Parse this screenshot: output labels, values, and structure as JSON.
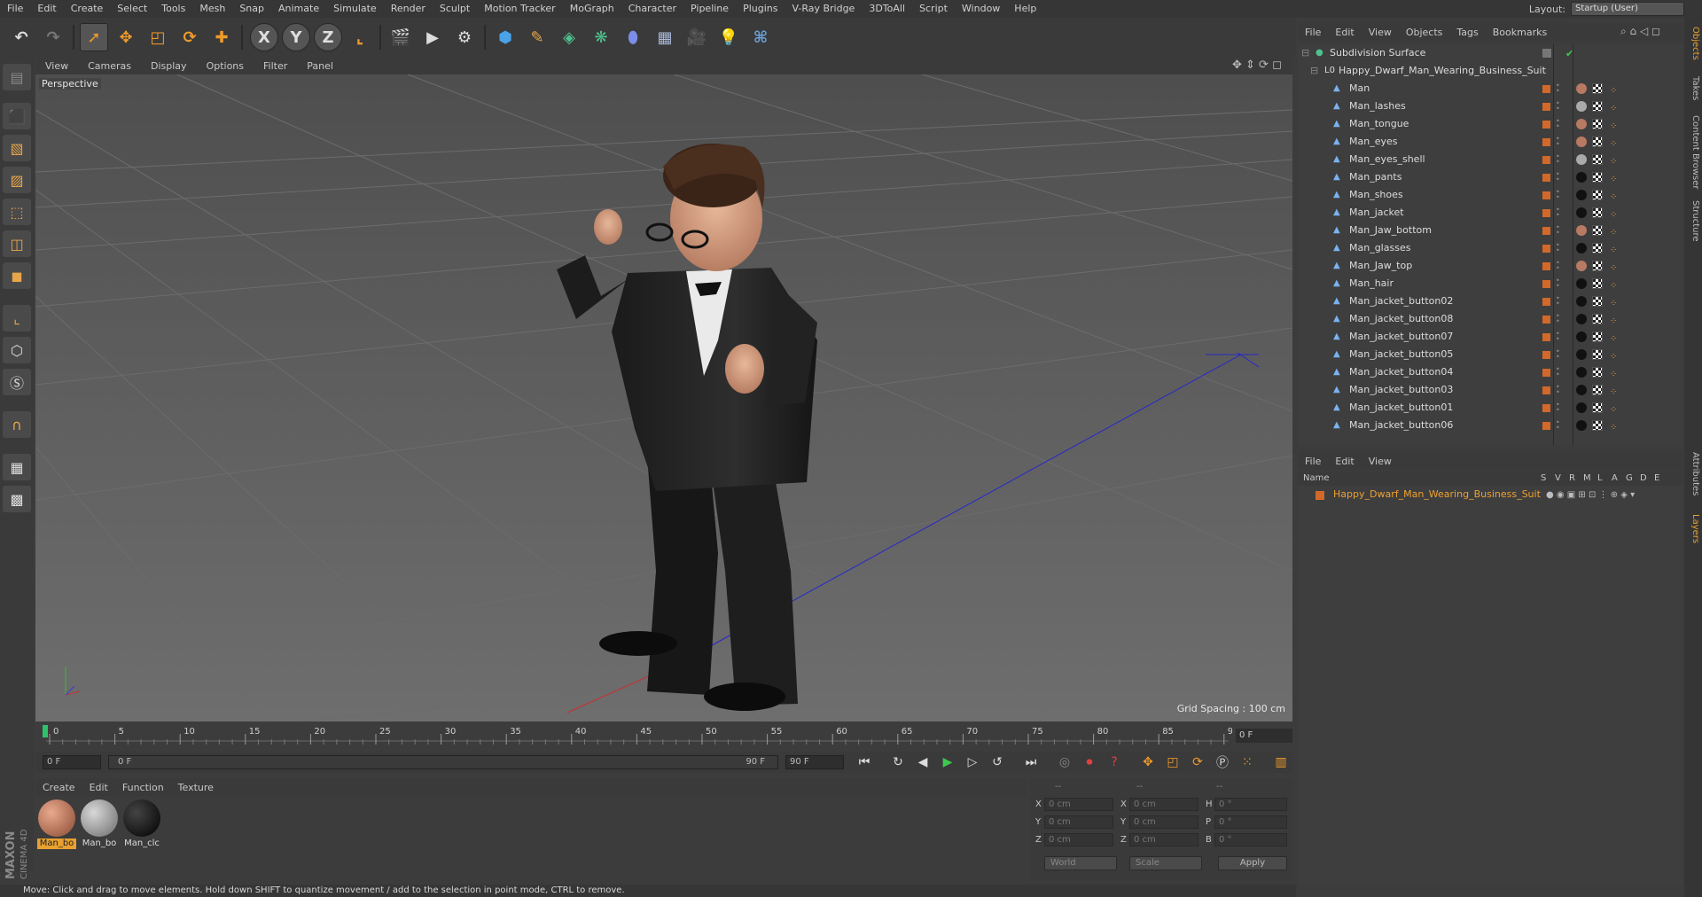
{
  "menubar": {
    "items": [
      "File",
      "Edit",
      "Create",
      "Select",
      "Tools",
      "Mesh",
      "Snap",
      "Animate",
      "Simulate",
      "Render",
      "Sculpt",
      "Motion Tracker",
      "MoGraph",
      "Character",
      "Pipeline",
      "Plugins",
      "V-Ray Bridge",
      "3DToAll",
      "Script",
      "Window",
      "Help"
    ],
    "layout_label": "Layout:",
    "layout_value": "Startup (User)"
  },
  "toolbar": {
    "icons": [
      "undo-icon",
      "redo-icon",
      "select-arrow-icon",
      "move-icon",
      "scale-icon",
      "rotate-icon",
      "add-icon",
      "x-axis-icon",
      "y-axis-icon",
      "z-axis-icon",
      "coordinate-system-icon",
      "render-view-icon",
      "render-picture-viewer-icon",
      "edit-render-settings-icon",
      "cube-primitive-icon",
      "pen-spline-icon",
      "subdivision-generator-icon",
      "cloner-icon",
      "deformer-icon",
      "floor-icon",
      "camera-icon",
      "light-icon",
      "python-icon"
    ],
    "axis_letters": [
      "X",
      "Y",
      "Z"
    ]
  },
  "viewport": {
    "menu": [
      "View",
      "Cameras",
      "Display",
      "Options",
      "Filter",
      "Panel"
    ],
    "label": "Perspective",
    "grid_spacing": "Grid Spacing : 100 cm"
  },
  "timeline": {
    "ticks": [
      "0",
      "5",
      "10",
      "15",
      "20",
      "25",
      "30",
      "35",
      "40",
      "45",
      "50",
      "55",
      "60",
      "65",
      "70",
      "75",
      "80",
      "85",
      "90"
    ],
    "end_frame": "0 F",
    "current_frame": "0 F",
    "range_start": "0 F",
    "range_end": "90 F",
    "range_end_inner": "90 F",
    "max_frame": "90 F"
  },
  "materials": {
    "menu": [
      "Create",
      "Edit",
      "Function",
      "Texture"
    ],
    "items": [
      {
        "label": "Man_bo",
        "selected": true,
        "color": "#c97b5a"
      },
      {
        "label": "Man_bo",
        "selected": false,
        "color": "#9b9b9b"
      },
      {
        "label": "Man_clc",
        "selected": false,
        "color": "#111111"
      }
    ]
  },
  "coordinates": {
    "header": [
      "--",
      "--",
      "--"
    ],
    "rows": [
      {
        "l1": "X",
        "v1": "0 cm",
        "l2": "X",
        "v2": "0 cm",
        "l3": "H",
        "v3": "0 °"
      },
      {
        "l1": "Y",
        "v1": "0 cm",
        "l2": "Y",
        "v2": "0 cm",
        "l3": "P",
        "v3": "0 °"
      },
      {
        "l1": "Z",
        "v1": "0 cm",
        "l2": "Z",
        "v2": "0 cm",
        "l3": "B",
        "v3": "0 °"
      }
    ],
    "mode": "World",
    "transform": "Scale",
    "apply": "Apply"
  },
  "status": "Move: Click and drag to move elements. Hold down SHIFT to quantize movement / add to the selection in point mode, CTRL to remove.",
  "brand": {
    "maxon": "MAXON",
    "product": "CINEMA 4D"
  },
  "object_manager": {
    "menu": [
      "File",
      "Edit",
      "View",
      "Objects",
      "Tags",
      "Bookmarks"
    ],
    "root": "Subdivision Surface",
    "group": "Happy_Dwarf_Man_Wearing_Business_Suit",
    "objects": [
      "Man",
      "Man_lashes",
      "Man_tongue",
      "Man_eyes",
      "Man_eyes_shell",
      "Man_pants",
      "Man_shoes",
      "Man_jacket",
      "Man_Jaw_bottom",
      "Man_glasses",
      "Man_Jaw_top",
      "Man_hair",
      "Man_jacket_button02",
      "Man_jacket_button08",
      "Man_jacket_button07",
      "Man_jacket_button05",
      "Man_jacket_button04",
      "Man_jacket_button03",
      "Man_jacket_button01",
      "Man_jacket_button06"
    ],
    "material_tag_colors": [
      "#b87a62",
      "#aaaaaa",
      "#b87a62",
      "#b87a62",
      "#aaaaaa",
      "#111111",
      "#111111",
      "#111111",
      "#b87a62",
      "#111111",
      "#b87a62",
      "#111111",
      "#111111",
      "#111111",
      "#111111",
      "#111111",
      "#111111",
      "#111111",
      "#111111",
      "#111111"
    ]
  },
  "layers": {
    "menu": [
      "File",
      "Edit",
      "View"
    ],
    "columns": {
      "name": "Name",
      "flags": [
        "S",
        "V",
        "R",
        "M",
        "L",
        "A",
        "G",
        "D",
        "E"
      ]
    },
    "items": [
      "Happy_Dwarf_Man_Wearing_Business_Suit"
    ]
  },
  "edge_tabs": [
    "Objects",
    "Takes",
    "Content Browser",
    "Structure",
    "Attributes",
    "Layers"
  ],
  "colors": {
    "accent": "#f09a2a",
    "selection": "#e8a030",
    "object_swatch": "#d2692a"
  }
}
